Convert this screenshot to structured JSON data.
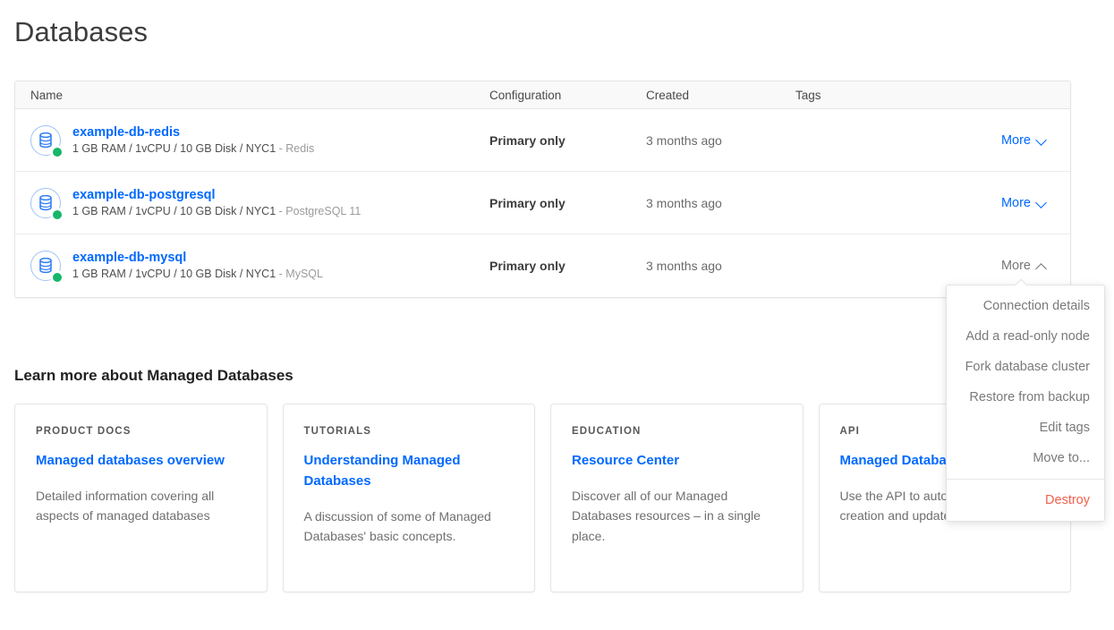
{
  "page": {
    "title": "Databases"
  },
  "table": {
    "columns": {
      "name": "Name",
      "configuration": "Configuration",
      "created": "Created",
      "tags": "Tags"
    },
    "rows": [
      {
        "name": "example-db-redis",
        "specs": "1 GB RAM / 1vCPU / 10 GB Disk / NYC1",
        "engine": "- Redis",
        "configuration": "Primary only",
        "created": "3 months ago",
        "tags": "",
        "more_label": "More",
        "menu_open": false,
        "status": "online",
        "status_color": "#15b76a",
        "icon": "database-icon"
      },
      {
        "name": "example-db-postgresql",
        "specs": "1 GB RAM / 1vCPU / 10 GB Disk / NYC1",
        "engine": "- PostgreSQL 11",
        "configuration": "Primary only",
        "created": "3 months ago",
        "tags": "",
        "more_label": "More",
        "menu_open": false,
        "status": "online",
        "status_color": "#15b76a",
        "icon": "database-icon"
      },
      {
        "name": "example-db-mysql",
        "specs": "1 GB RAM / 1vCPU / 10 GB Disk / NYC1",
        "engine": "- MySQL",
        "configuration": "Primary only",
        "created": "3 months ago",
        "tags": "",
        "more_label": "More",
        "menu_open": true,
        "status": "online",
        "status_color": "#15b76a",
        "icon": "database-icon"
      }
    ]
  },
  "dropdown": {
    "open": true,
    "owner_row": "example-db-mysql",
    "items": [
      {
        "label": "Connection details",
        "danger": false
      },
      {
        "label": "Add a read-only node",
        "danger": false
      },
      {
        "label": "Fork database cluster",
        "danger": false
      },
      {
        "label": "Restore from backup",
        "danger": false
      },
      {
        "label": "Edit tags",
        "danger": false
      },
      {
        "label": "Move to...",
        "danger": false
      }
    ],
    "destructive": {
      "label": "Destroy",
      "color": "#f0614c"
    }
  },
  "learn_more": {
    "heading": "Learn more about Managed Databases",
    "cards": [
      {
        "eyebrow": "PRODUCT DOCS",
        "link": "Managed databases overview",
        "description": "Detailed information covering all aspects of managed databases"
      },
      {
        "eyebrow": "TUTORIALS",
        "link": "Understanding Managed Databases",
        "description": "A discussion of some of Managed Databases' basic concepts."
      },
      {
        "eyebrow": "EDUCATION",
        "link": "Resource Center",
        "description": "Discover all of our Managed Databases resources – in a single place."
      },
      {
        "eyebrow": "API",
        "link": "Managed Databases API",
        "description": "Use the API to automate cluster creation and updates."
      }
    ]
  },
  "colors": {
    "link": "#0069ff",
    "danger": "#f0614c",
    "status_online": "#15b76a",
    "border": "#e5e5e5",
    "header_bg": "#f9f9f9"
  }
}
